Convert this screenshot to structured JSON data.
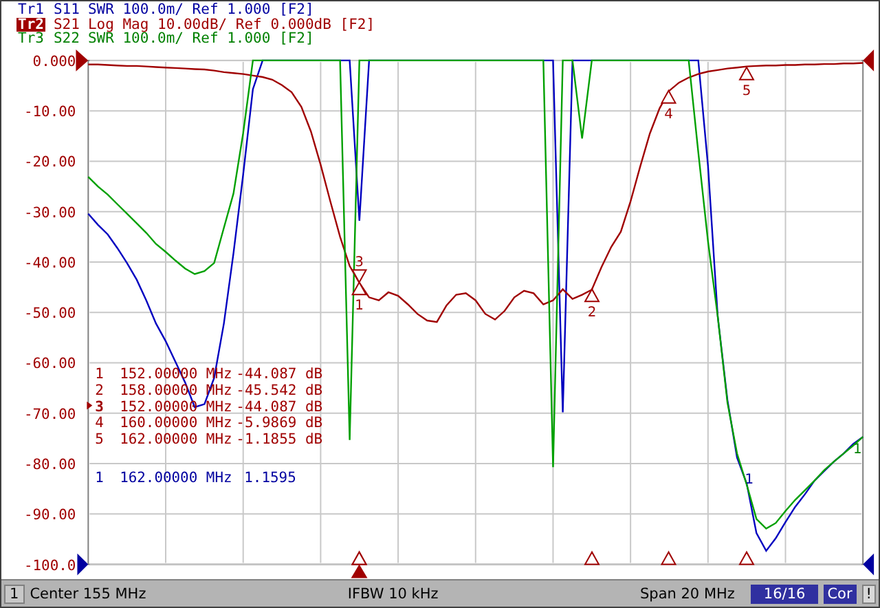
{
  "traces": [
    {
      "name": "Tr1",
      "text": "SWR 100.0m/ Ref 1.000 [F2]",
      "color": "#0000a0",
      "selected": false
    },
    {
      "name": "Tr2",
      "text": "Log Mag 10.00dB/ Ref 0.000dB [F2]",
      "color": "#a00000",
      "selected": true
    },
    {
      "name": "Tr3",
      "text": "SWR 100.0m/ Ref 1.000 [F2]",
      "color": "#008000",
      "selected": false
    }
  ],
  "chart_data": {
    "type": "line",
    "ylim": [
      -100,
      0
    ],
    "grid": true,
    "yticks": [
      {
        "value": 0,
        "label": "0.000"
      },
      {
        "value": -10,
        "label": "-10.00"
      },
      {
        "value": -20,
        "label": "-20.00"
      },
      {
        "value": -30,
        "label": "-30.00"
      },
      {
        "value": -40,
        "label": "-40.00"
      },
      {
        "value": -50,
        "label": "-50.00"
      },
      {
        "value": -60,
        "label": "-60.00"
      },
      {
        "value": -70,
        "label": "-70.00"
      },
      {
        "value": -80,
        "label": "-80.00"
      },
      {
        "value": -90,
        "label": "-90.00"
      },
      {
        "value": -100,
        "label": "-100.0"
      }
    ],
    "categories": [
      null,
      null,
      null,
      null,
      null,
      null,
      null,
      null,
      null,
      null,
      null,
      null,
      null,
      null,
      null,
      null,
      null,
      null,
      null,
      null,
      null,
      null,
      null,
      null,
      null,
      null,
      null,
      null,
      null,
      null,
      null,
      null,
      null,
      null,
      null,
      null,
      null,
      null,
      null,
      null,
      null,
      null,
      null,
      null,
      null,
      null,
      null,
      null,
      null,
      null,
      null,
      null,
      null,
      null,
      null,
      null,
      null,
      null,
      null,
      null,
      null,
      null,
      null,
      null,
      null,
      null,
      null,
      null,
      null,
      null,
      null,
      null,
      null,
      null,
      null,
      null,
      null,
      null,
      null,
      null,
      null
    ],
    "series": [
      {
        "name": "S11",
        "color": "#0000c0",
        "values": [
          -30.4,
          -32.6,
          -34.5,
          -37.2,
          -40.2,
          -43.5,
          -47.6,
          -52.2,
          -55.7,
          -59.8,
          -63.9,
          -68.8,
          -68.2,
          -63,
          -52.2,
          -38.3,
          -22.6,
          -5.7,
          0,
          0,
          0,
          0,
          0,
          0,
          0,
          0,
          0,
          0,
          -31.8,
          0,
          0,
          0,
          0,
          0,
          0,
          0,
          0,
          0,
          0,
          0,
          0,
          0,
          0,
          0,
          0,
          0,
          0,
          0,
          0,
          -69.8,
          0,
          0,
          0,
          0,
          0,
          0,
          0,
          0,
          0,
          0,
          0,
          0,
          0,
          0,
          -20.9,
          -50.8,
          -67.4,
          -78.8,
          -84,
          -93.8,
          -97.3,
          -94.8,
          -91.6,
          -88.6,
          -86.1,
          -83.4,
          -81.5,
          -79.6,
          -78,
          -76.1,
          -74.7
        ]
      },
      {
        "name": "S21",
        "color": "#a00000",
        "values": [
          -0.8,
          -0.8,
          -0.9,
          -1.0,
          -1.1,
          -1.1,
          -1.2,
          -1.3,
          -1.4,
          -1.5,
          -1.6,
          -1.7,
          -1.8,
          -2.0,
          -2.3,
          -2.5,
          -2.7,
          -3.0,
          -3.3,
          -3.8,
          -4.9,
          -6.3,
          -9.2,
          -14.1,
          -20.7,
          -28,
          -35,
          -40.8,
          -44.1,
          -47,
          -47.6,
          -46,
          -46.7,
          -48.4,
          -50.3,
          -51.6,
          -51.9,
          -48.6,
          -46.5,
          -46.2,
          -47.6,
          -50.3,
          -51.4,
          -49.7,
          -47,
          -45.7,
          -46.2,
          -48.4,
          -47.6,
          -45.4,
          -47.3,
          -46.5,
          -45.5,
          -41,
          -37,
          -34,
          -28,
          -21,
          -14.5,
          -9.5,
          -6.0,
          -4.4,
          -3.4,
          -2.7,
          -2.2,
          -1.9,
          -1.6,
          -1.4,
          -1.2,
          -1.1,
          -1.0,
          -1.0,
          -0.9,
          -0.9,
          -0.8,
          -0.8,
          -0.7,
          -0.7,
          -0.6,
          -0.6,
          -0.5
        ]
      },
      {
        "name": "S22",
        "color": "#00a000",
        "values": [
          -23.1,
          -25,
          -26.6,
          -28.5,
          -30.4,
          -32.3,
          -34.2,
          -36.4,
          -38,
          -39.7,
          -41.3,
          -42.4,
          -41.8,
          -40.2,
          -33.2,
          -26.4,
          -14.4,
          0,
          0,
          0,
          0,
          0,
          0,
          0,
          0,
          0,
          0,
          -75.3,
          0,
          0,
          0,
          0,
          0,
          0,
          0,
          0,
          0,
          0,
          0,
          0,
          0,
          0,
          0,
          0,
          0,
          0,
          0,
          0,
          -80.7,
          0,
          0,
          -15.5,
          0,
          0,
          0,
          0,
          0,
          0,
          0,
          0,
          0,
          0,
          0,
          -18.2,
          -35.9,
          -50.8,
          -67.9,
          -78,
          -84.2,
          -91,
          -92.9,
          -91.8,
          -89.4,
          -87.2,
          -85.3,
          -83.4,
          -81.3,
          -79.6,
          -78,
          -76.4,
          -74.7
        ]
      }
    ]
  },
  "trace_marker_labels": [
    "1",
    "2",
    "3",
    "4",
    "5"
  ],
  "swr_marker_labels": [
    {
      "label": "1",
      "color": "#0000a0"
    },
    {
      "label": "1",
      "color": "#008000"
    }
  ],
  "marker_table": [
    {
      "number": "1",
      "frequency": "152.00000 MHz",
      "value": "-44.087 dB",
      "active": false
    },
    {
      "number": "2",
      "frequency": "158.00000 MHz",
      "value": "-45.542 dB",
      "active": false
    },
    {
      "number": "3",
      "frequency": "152.00000 MHz",
      "value": "-44.087 dB",
      "active": true
    },
    {
      "number": "4",
      "frequency": "160.00000 MHz",
      "value": "-5.9869 dB",
      "active": false
    },
    {
      "number": "5",
      "frequency": "162.00000 MHz",
      "value": "-1.1855 dB",
      "active": false
    }
  ],
  "swr_marker_table": [
    {
      "number": "1",
      "frequency": "162.00000 MHz",
      "value": "1.1595"
    }
  ],
  "status_bar": {
    "channel": "1",
    "center": "Center 155 MHz",
    "ifbw": "IFBW 10 kHz",
    "span": "Span 20 MHz",
    "sweep": "16/16",
    "correction": "Cor",
    "warning": "!"
  }
}
